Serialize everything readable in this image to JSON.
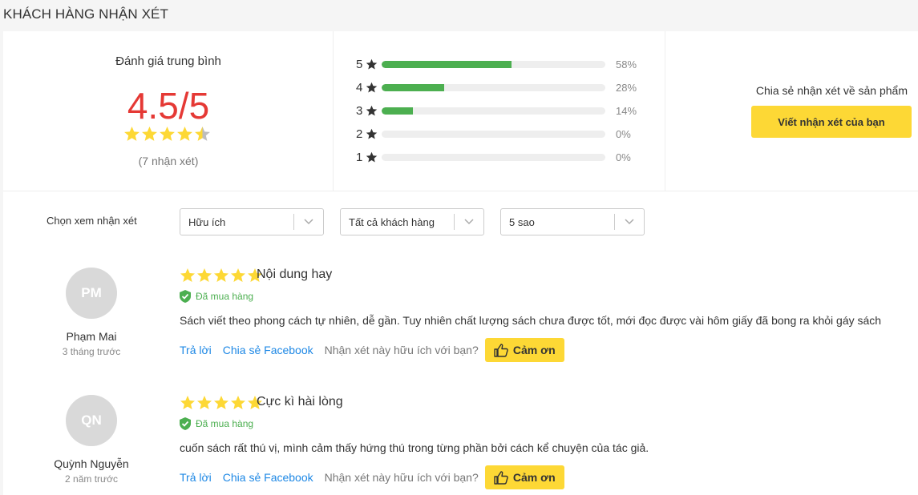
{
  "section_title": "KHÁCH HÀNG NHẬN XÉT",
  "summary": {
    "avg_label": "Đánh giá trung bình",
    "avg_score": "4.5/5",
    "rating": 4.5,
    "count_text": "(7 nhận xét)",
    "bars": [
      {
        "stars": "5",
        "percent_text": "58%",
        "percent": 58
      },
      {
        "stars": "4",
        "percent_text": "28%",
        "percent": 28
      },
      {
        "stars": "3",
        "percent_text": "14%",
        "percent": 14
      },
      {
        "stars": "2",
        "percent_text": "0%",
        "percent": 0
      },
      {
        "stars": "1",
        "percent_text": "0%",
        "percent": 0
      }
    ],
    "share_text": "Chia sẻ nhận xét về sản phẩm",
    "write_button": "Viết nhận xét của bạn"
  },
  "filters": {
    "label": "Chọn xem nhận xét",
    "sort": "Hữu ích",
    "customers": "Tất cả khách hàng",
    "stars": "5 sao"
  },
  "reviews": [
    {
      "initials": "PM",
      "name": "Phạm Mai",
      "time": "3 tháng trước",
      "rating": 5,
      "title": "Nội dung hay",
      "bought": "Đã mua hàng",
      "text": "Sách viết theo phong cách tự nhiên, dễ gần. Tuy nhiên chất lượng sách chưa được tốt, mới đọc được vài hôm giấy đã bong ra khỏi gáy sách",
      "reply": "Trả lời",
      "share": "Chia sẻ Facebook",
      "helpful_q": "Nhận xét này hữu ích với bạn?",
      "thanks": "Cảm ơn"
    },
    {
      "initials": "QN",
      "name": "Quỳnh Nguyễn",
      "time": "2 năm trước",
      "rating": 5,
      "title": "Cực kì hài lòng",
      "bought": "Đã mua hàng",
      "text": "cuốn sách rất thú vị, mình cảm thấy hứng thú trong từng phần bởi cách kể chuyện của tác giả.",
      "reply": "Trả lời",
      "share": "Chia sẻ Facebook",
      "helpful_q": "Nhận xét này hữu ích với bạn?",
      "thanks": "Cảm ơn"
    }
  ],
  "colors": {
    "star": "#fdd835",
    "star_empty": "#bdbdbd",
    "bar_fill": "#4caf50",
    "score": "#e53935",
    "link": "#1e88e5",
    "button": "#fdd835"
  },
  "icons": {
    "star": "star-icon",
    "shield": "verified-shield-icon",
    "thumb": "thumbs-up-icon",
    "chevron": "chevron-down-icon"
  }
}
